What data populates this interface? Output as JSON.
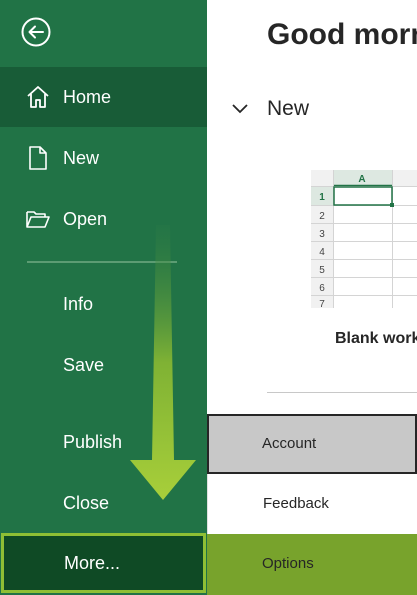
{
  "sidebar": {
    "items": [
      {
        "label": "Home",
        "icon": "home-icon"
      },
      {
        "label": "New",
        "icon": "new-document-icon"
      },
      {
        "label": "Open",
        "icon": "open-folder-icon"
      },
      {
        "label": "Info"
      },
      {
        "label": "Save"
      },
      {
        "label": "Publish"
      },
      {
        "label": "Close"
      },
      {
        "label": "More..."
      }
    ],
    "back_icon": "back-arrow-icon"
  },
  "main": {
    "greeting": "Good morning",
    "new_section": {
      "title": "New",
      "template": {
        "label": "Blank workbook",
        "column_header": "A",
        "rows": [
          "1",
          "2",
          "3",
          "4",
          "5",
          "6",
          "7"
        ]
      }
    }
  },
  "more_menu": {
    "items": [
      "Account",
      "Feedback",
      "Options"
    ]
  },
  "colors": {
    "sidebar": "#217346",
    "selected": "#185c37",
    "highlight": "#8fbf35"
  }
}
